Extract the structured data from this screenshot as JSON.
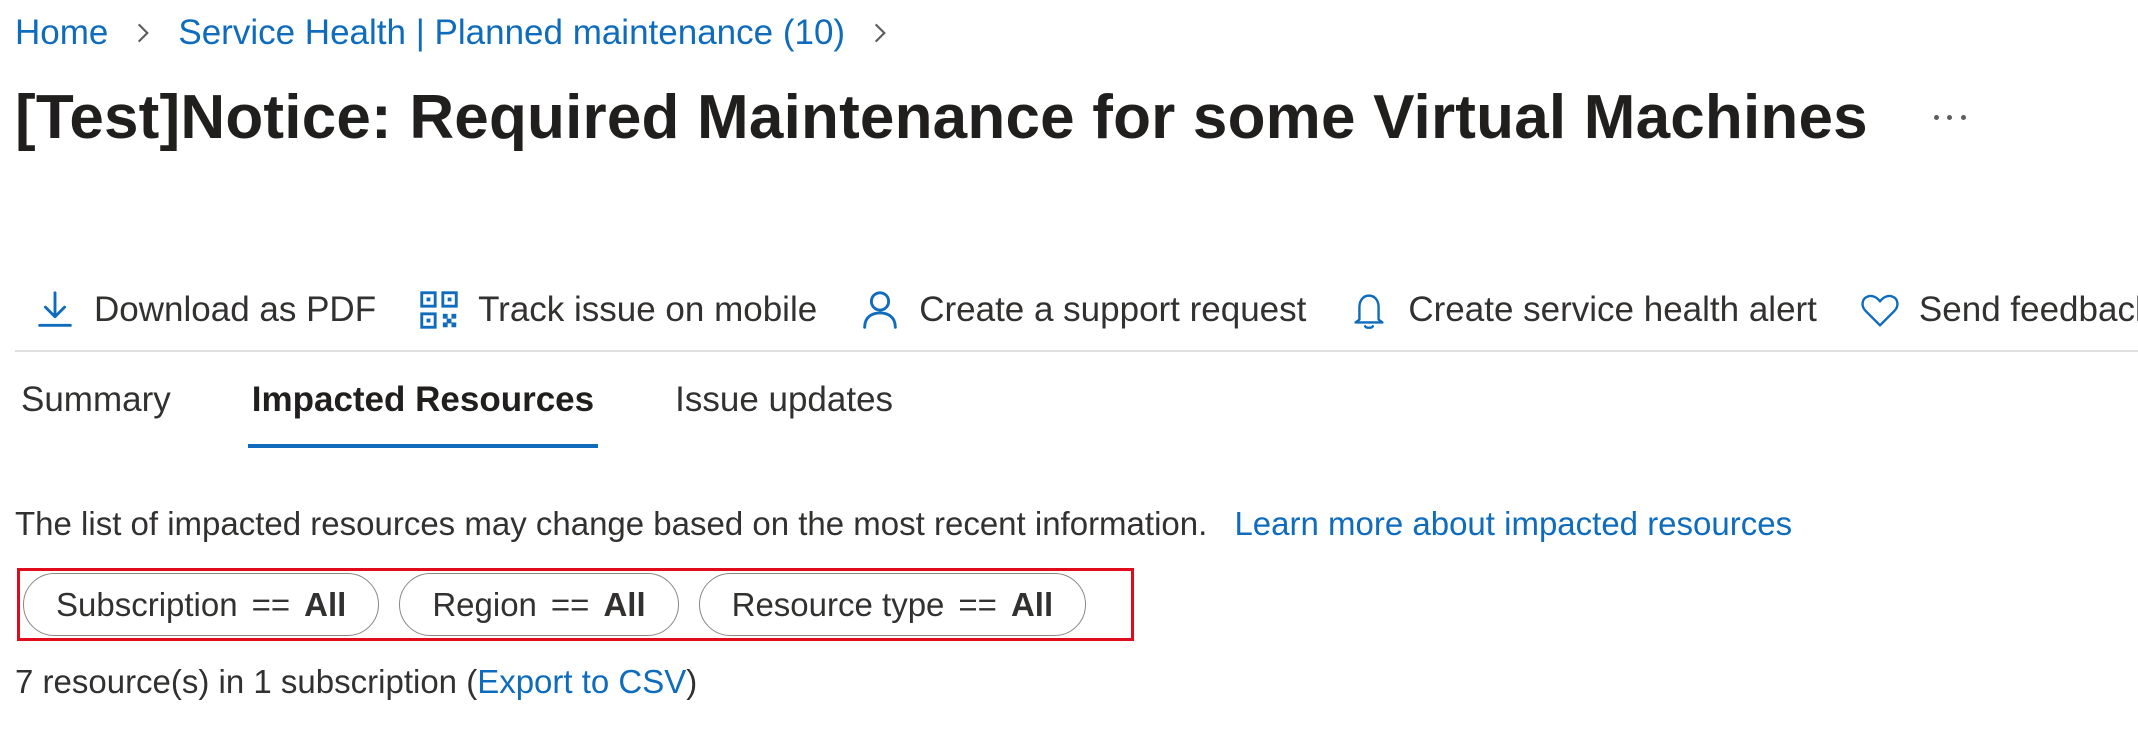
{
  "breadcrumb": {
    "home": "Home",
    "service_health": "Service Health | Planned maintenance (10)"
  },
  "title": "[Test]Notice: Required Maintenance for some Virtual Machines",
  "commands": {
    "download_pdf": "Download as PDF",
    "track_mobile": "Track issue on mobile",
    "support_request": "Create a support request",
    "health_alert": "Create service health alert",
    "send_feedback": "Send feedback"
  },
  "tabs": {
    "summary": "Summary",
    "impacted_resources": "Impacted Resources",
    "issue_updates": "Issue updates"
  },
  "info": {
    "text": "The list of impacted resources may change based on the most recent information.",
    "link": "Learn more about impacted resources"
  },
  "filters": {
    "subscription": {
      "label": "Subscription",
      "op": "==",
      "value": "All"
    },
    "region": {
      "label": "Region",
      "op": "==",
      "value": "All"
    },
    "resource_type": {
      "label": "Resource type",
      "op": "==",
      "value": "All"
    }
  },
  "count": {
    "text": "7 resource(s) in 1 subscription (",
    "export_link": "Export to CSV",
    "close": ")"
  },
  "colors": {
    "link": "#0f6cbd",
    "highlight_border": "#e00b1c"
  }
}
